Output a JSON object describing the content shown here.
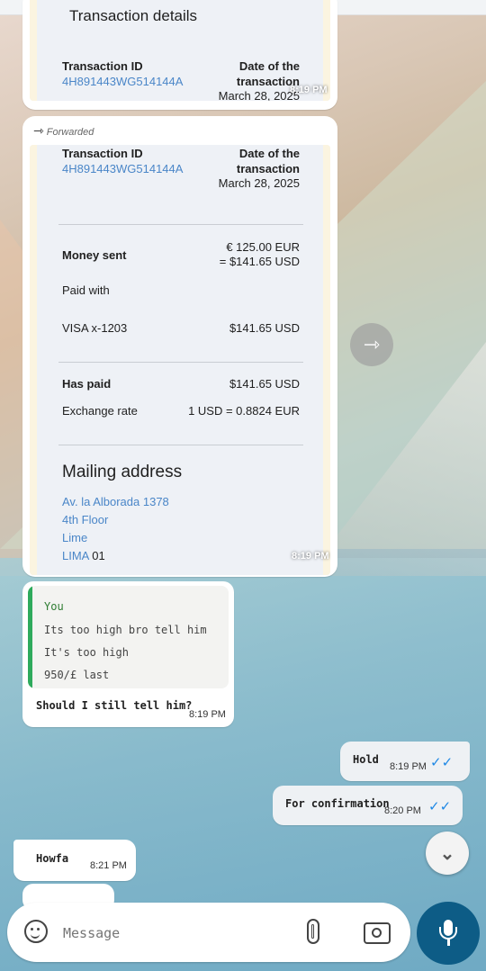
{
  "card1": {
    "heading": "Transaction details",
    "txn_label": "Transaction ID",
    "txn_id": "4H891443WG514144A",
    "date_label_1": "Date of the",
    "date_label_2": "transaction",
    "date": "March 28, 2025",
    "time": "8:19 PM"
  },
  "card2": {
    "forwarded": "Forwarded",
    "txn_label": "Transaction ID",
    "txn_id": "4H891443WG514144A",
    "date_label_1": "Date of the",
    "date_label_2": "transaction",
    "date": "March 28, 2025",
    "money_sent_label": "Money sent",
    "money_sent_eur": "€ 125.00 EUR",
    "money_sent_usd": "= $141.65 USD",
    "paid_with_label": "Paid with",
    "card_name": "VISA x-1203",
    "card_amount": "$141.65 USD",
    "has_paid_label": "Has paid",
    "has_paid_amount": "$141.65 USD",
    "exchange_label": "Exchange rate",
    "exchange_value": "1 USD = 0.8824 EUR",
    "mailing_title": "Mailing address",
    "addr1": "Av. la Alborada 1378",
    "addr2": "4th Floor",
    "addr3": "Lime",
    "addr4a": "LIMA",
    "addr4b": " 01",
    "time": "8:19 PM"
  },
  "reply": {
    "quote_author": "You",
    "quote_lines": [
      "Its too high bro tell him",
      "It's too high",
      "950/£ last"
    ],
    "message": "Should I still tell him?",
    "time": "8:19 PM"
  },
  "out1": {
    "text": "Hold",
    "time": "8:19 PM"
  },
  "out2": {
    "text": "For confirmation",
    "time": "8:20 PM"
  },
  "in1": {
    "text": "Howfa",
    "time": "8:21 PM"
  },
  "composer": {
    "placeholder": "Message"
  },
  "colors": {
    "accent": "#0d5c86",
    "quote_bar": "#2eaa5c",
    "tick": "#1e88e5"
  }
}
